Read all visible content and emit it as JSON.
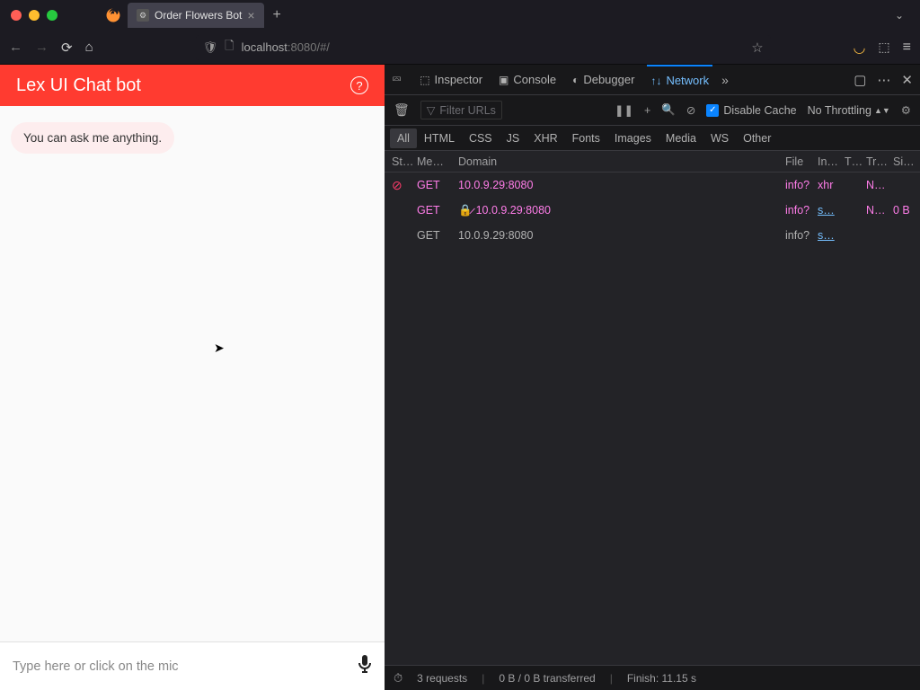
{
  "browser": {
    "tab_title": "Order Flowers Bot",
    "url_display": "localhost:8080/#/",
    "url_host": "localhost",
    "url_rest": ":8080/#/"
  },
  "chat": {
    "title": "Lex UI Chat bot",
    "greeting": "You can ask me anything.",
    "input_placeholder": "Type here or click on the mic"
  },
  "devtools": {
    "tabs": {
      "inspector": "Inspector",
      "console": "Console",
      "debugger": "Debugger",
      "network": "Network"
    },
    "filter_placeholder": "Filter URLs",
    "disable_cache": "Disable Cache",
    "throttling": "No Throttling",
    "filters": [
      "All",
      "HTML",
      "CSS",
      "JS",
      "XHR",
      "Fonts",
      "Images",
      "Media",
      "WS",
      "Other"
    ],
    "columns": {
      "status": "Stat…",
      "method": "Me…",
      "domain": "Domain",
      "file": "File",
      "init": "In…",
      "type": "T…",
      "trans": "Tr…",
      "size": "Si…"
    },
    "rows": [
      {
        "blocked": true,
        "method": "GET",
        "domain": "10.0.9.29:8080",
        "file": "info?",
        "init": "xhr",
        "trans": "N…",
        "size": ""
      },
      {
        "blocked": false,
        "strike": true,
        "method": "GET",
        "domain": "10.0.9.29:8080",
        "file": "info?",
        "init": "s…",
        "trans": "N…",
        "size": "0 B"
      },
      {
        "blocked": false,
        "method": "GET",
        "domain": "10.0.9.29:8080",
        "file": "info?",
        "init": "s…",
        "trans": "",
        "size": ""
      }
    ],
    "status_bar": {
      "requests": "3 requests",
      "transferred": "0 B / 0 B transferred",
      "finish": "Finish: 11.15 s"
    }
  }
}
